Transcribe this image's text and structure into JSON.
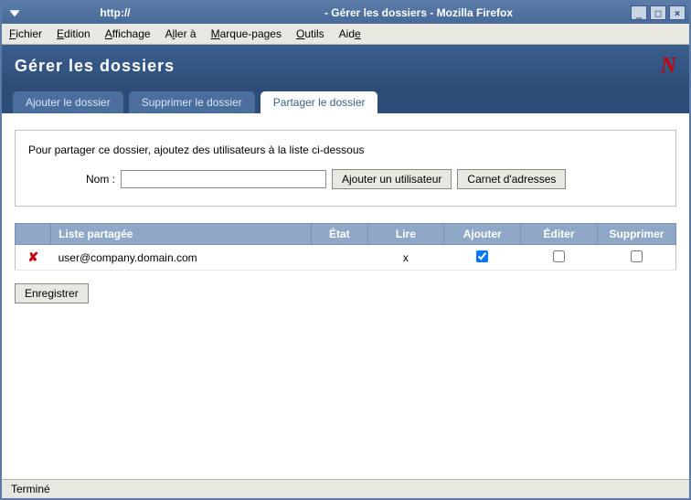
{
  "window": {
    "url": "http://",
    "title": "- Gérer les dossiers - Mozilla Firefox"
  },
  "menubar": {
    "file": "Fichier",
    "edit": "Edition",
    "view": "Affichage",
    "go": "Aller à",
    "bookmarks": "Marque-pages",
    "tools": "Outils",
    "help": "Aide"
  },
  "header": {
    "title": "Gérer les dossiers",
    "logo": "N"
  },
  "tabs": {
    "add": "Ajouter le dossier",
    "delete": "Supprimer le dossier",
    "share": "Partager le dossier"
  },
  "panel": {
    "instruction": "Pour partager ce dossier, ajoutez des utilisateurs à la liste ci-dessous",
    "name_label": "Nom :",
    "add_user_btn": "Ajouter un utilisateur",
    "addressbook_btn": "Carnet d'adresses"
  },
  "table": {
    "headers": {
      "shared_list": "Liste partagée",
      "state": "État",
      "read": "Lire",
      "add": "Ajouter",
      "edit": "Éditer",
      "remove": "Supprimer"
    },
    "rows": [
      {
        "user": "user@company.domain.com",
        "state": "",
        "read": "x",
        "add_checked": true,
        "edit_checked": false,
        "remove_checked": false
      }
    ]
  },
  "save_btn": "Enregistrer",
  "status": "Terminé"
}
